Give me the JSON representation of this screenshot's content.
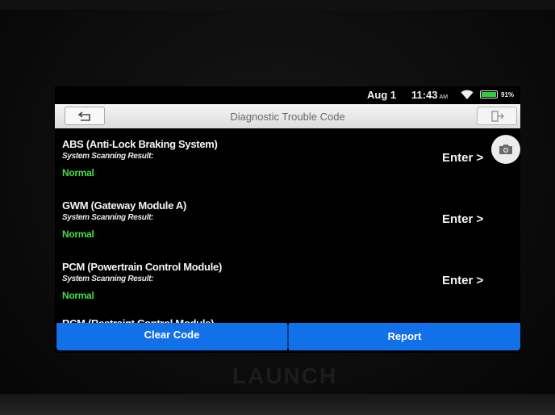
{
  "status_bar": {
    "date": "Aug 1",
    "time": "11:43",
    "ampm": "AM",
    "battery": "91%"
  },
  "header": {
    "title": "Diagnostic Trouble Code"
  },
  "modules": [
    {
      "name": "ABS (Anti-Lock Braking System)",
      "result_label": "System Scanning Result:",
      "status": "Normal",
      "action": "Enter >"
    },
    {
      "name": "GWM (Gateway Module A)",
      "result_label": "System Scanning Result:",
      "status": "Normal",
      "action": "Enter >"
    },
    {
      "name": "PCM (Powertrain Control Module)",
      "result_label": "System Scanning Result:",
      "status": "Normal",
      "action": "Enter >"
    },
    {
      "name": "RCM (Restraint Control Module)"
    }
  ],
  "bottom_bar": {
    "clear_code": "Clear Code",
    "report": "Report"
  },
  "device": {
    "brand": "LAUNCH"
  },
  "colors": {
    "accent": "#1270e8",
    "status_ok": "#44dd44",
    "background": "#000000"
  },
  "icons": {
    "back": "back-arrow-icon",
    "exit": "exit-icon",
    "camera": "camera-icon",
    "wifi": "wifi-icon",
    "battery": "battery-icon"
  }
}
